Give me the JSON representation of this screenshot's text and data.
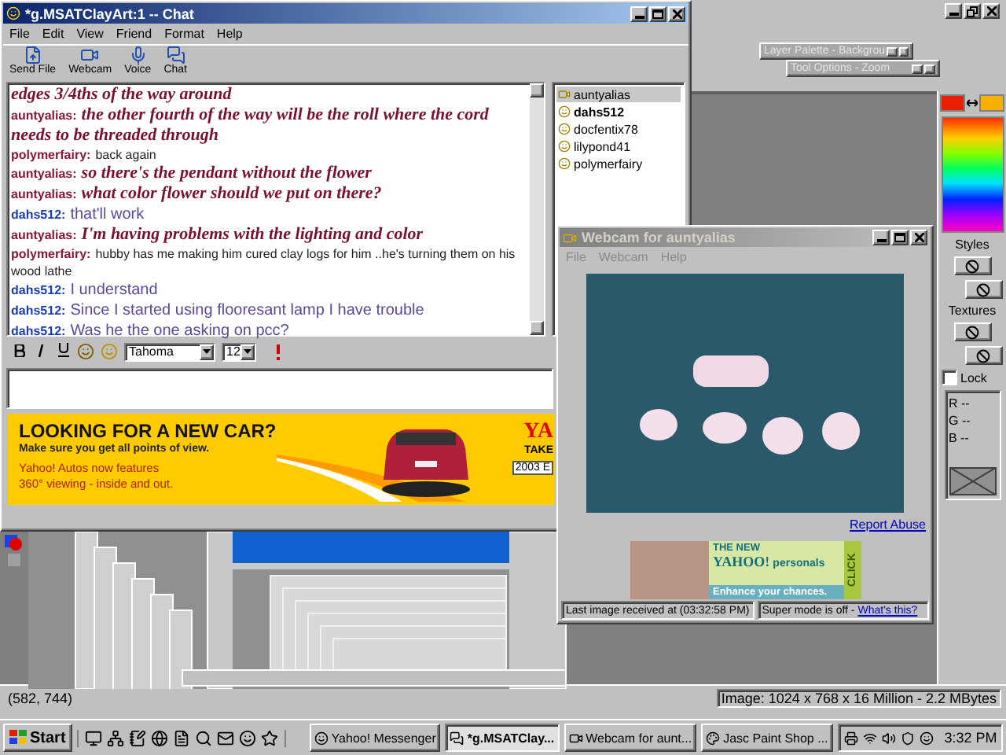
{
  "paint_shop": {
    "palettes": [
      {
        "title": "Layer Palette - Backgrou"
      },
      {
        "title": "Tool Options - Zoom"
      }
    ],
    "color_panel": {
      "styles_label": "Styles",
      "textures_label": "Textures",
      "lock": {
        "label": "Lock",
        "checked": false
      },
      "channels": [
        "R --",
        "G --",
        "B --"
      ]
    },
    "status_bar": {
      "cursor": "(582, 744)",
      "image_info": "Image: 1024 x 768 x 16 Million - 2.2 MBytes"
    }
  },
  "chat_window": {
    "title": "*g.MSATClayArt:1 -- Chat",
    "menu": [
      "File",
      "Edit",
      "View",
      "Friend",
      "Format",
      "Help"
    ],
    "toolbar": [
      {
        "label": "Send File",
        "kind": "file"
      },
      {
        "label": "Webcam",
        "kind": "webcam"
      },
      {
        "label": "Voice",
        "kind": "voice"
      },
      {
        "label": "Chat",
        "kind": "chat"
      }
    ],
    "messages": [
      {
        "kind": "script",
        "text": "edges 3/4ths of the way around"
      },
      {
        "kind": "script",
        "sender": "auntyalias:",
        "color": "#8b1538",
        "text": "the other fourth of the way will be the roll where the cord needs to be threaded through"
      },
      {
        "kind": "plain",
        "sender": "polymerfairy:",
        "color": "#8b1538",
        "text": "back again"
      },
      {
        "kind": "script",
        "sender": "auntyalias:",
        "color": "#8b1538",
        "text": "so there's the pendant without the flower"
      },
      {
        "kind": "script",
        "sender": "auntyalias:",
        "color": "#8b1538",
        "text": "what color flower should we put on there?"
      },
      {
        "kind": "light",
        "sender": "dahs512:",
        "color": "#1c3cb4",
        "text": "that'll work"
      },
      {
        "kind": "script",
        "sender": "auntyalias:",
        "color": "#8b1538",
        "text": "I'm having problems with the lighting and color"
      },
      {
        "kind": "plain",
        "sender": "polymerfairy:",
        "color": "#8b1538",
        "text": "hubby has me making him cured clay logs for him ..he's turning them on his wood lathe"
      },
      {
        "kind": "light",
        "sender": "dahs512:",
        "color": "#1c3cb4",
        "text": "I understand"
      },
      {
        "kind": "light",
        "sender": "dahs512:",
        "color": "#1c3cb4",
        "text": "Since I started using flooresant lamp I have trouble"
      },
      {
        "kind": "light",
        "sender": "dahs512:",
        "color": "#1c3cb4",
        "text": "Was he the one asking on pcc?"
      }
    ],
    "users": [
      {
        "name": "auntyalias",
        "kind": "webcam",
        "selected": true,
        "bold": false
      },
      {
        "name": "dahs512",
        "kind": "smiley",
        "selected": false,
        "bold": true
      },
      {
        "name": "docfentix78",
        "kind": "smiley",
        "selected": false,
        "bold": false
      },
      {
        "name": "lilypond41",
        "kind": "smiley",
        "selected": false,
        "bold": false
      },
      {
        "name": "polymerfairy",
        "kind": "smiley",
        "selected": false,
        "bold": false
      }
    ],
    "format_bar": {
      "font": "Tahoma",
      "size": "12"
    },
    "ad": {
      "headline": "LOOKING FOR A NEW CAR?",
      "subline": "Make sure you get all points of view.",
      "features": [
        "Yahoo! Autos now features",
        "360° viewing - inside and out."
      ],
      "brand": "YA",
      "take": "TAKE",
      "field_value": "2003 E"
    }
  },
  "webcam_window": {
    "title": "Webcam for auntyalias",
    "menu": [
      "File",
      "Webcam",
      "Help"
    ],
    "report_link": "Report Abuse",
    "ad": {
      "kicker": "THE NEW",
      "brand": "YAHOO!",
      "product": "personals",
      "tagline": "Enhance your chances.",
      "cta": "CLICK"
    },
    "status": {
      "last_image": "Last image received at (03:32:58 PM)",
      "mode": "Super mode is off -",
      "help_link": "What's this?"
    }
  },
  "taskbar": {
    "start": "Start",
    "tasks": [
      {
        "label": "Yahoo! Messenger",
        "kind": "messenger",
        "selected": false
      },
      {
        "label": "*g.MSATClay...",
        "kind": "chat",
        "selected": true
      },
      {
        "label": "Webcam for aunt...",
        "kind": "webcam",
        "selected": false
      },
      {
        "label": "Jasc Paint Shop ...",
        "kind": "paint",
        "selected": false
      }
    ],
    "clock": "3:32 PM"
  }
}
